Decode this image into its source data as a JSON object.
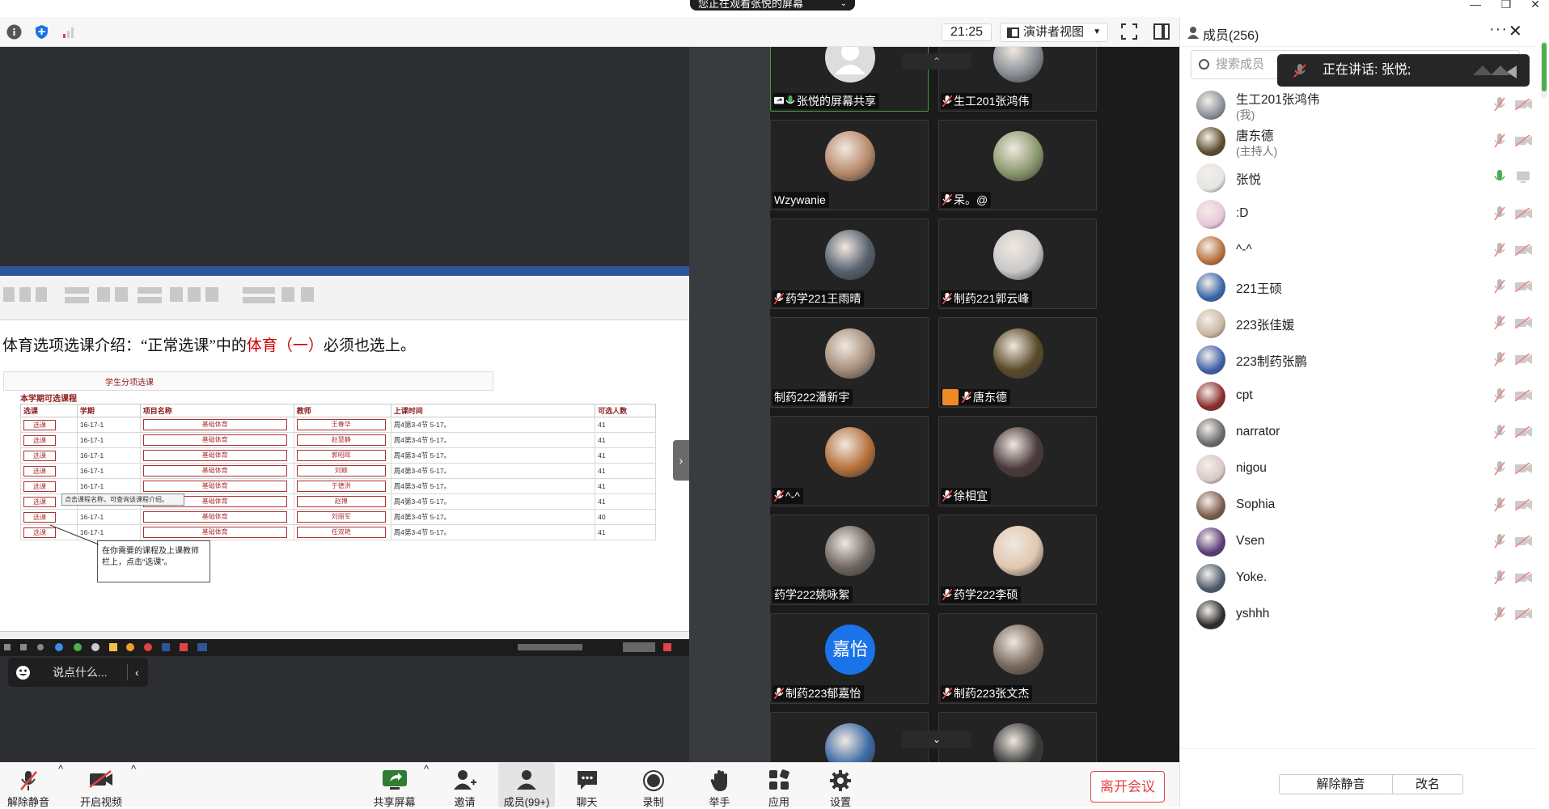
{
  "top": {
    "share_banner": "您正在观看张悦的屏幕",
    "minimize": "—",
    "restore": "❐",
    "close": "✕"
  },
  "toolbar": {
    "time": "21:25",
    "view_mode": "演讲者视图"
  },
  "doc": {
    "intro_a": "体育选项选课介绍：“正常选课”中的",
    "intro_red": "体育（一）",
    "intro_b": "必须也选上。",
    "section_title": "学生分项选课",
    "table_title": "本学期可选课程",
    "headers": [
      "选课",
      "学期",
      "项目名称",
      "教师",
      "上课时间",
      "可选人数"
    ],
    "rows": [
      {
        "btn": "选课",
        "term": "16-17-1",
        "proj": "基础体育",
        "teacher": "王春华",
        "time": "周4第3-4节 5-17。",
        "cap": "41"
      },
      {
        "btn": "选课",
        "term": "16-17-1",
        "proj": "基础体育",
        "teacher": "赵慧静",
        "time": "周4第3-4节 5-17。",
        "cap": "41"
      },
      {
        "btn": "选课",
        "term": "16-17-1",
        "proj": "基础体育",
        "teacher": "郭昭晖",
        "time": "周4第3-4节 5-17。",
        "cap": "41"
      },
      {
        "btn": "选课",
        "term": "16-17-1",
        "proj": "基础体育",
        "teacher": "刘颖",
        "time": "周4第3-4节 5-17。",
        "cap": "41"
      },
      {
        "btn": "选课",
        "term": "16-17-1",
        "proj": "基础体育",
        "teacher": "于德洪",
        "time": "周4第3-4节 5-17。",
        "cap": "41"
      },
      {
        "btn": "选课",
        "term": "16-17-1",
        "proj": "基础体育",
        "teacher": "赵博",
        "time": "周4第3-4节 5-17。",
        "cap": "41"
      },
      {
        "btn": "选课",
        "term": "16-17-1",
        "proj": "基础体育",
        "teacher": "刘丽军",
        "time": "周4第3-4节 5-17。",
        "cap": "40"
      },
      {
        "btn": "选课",
        "term": "16-17-1",
        "proj": "基础体育",
        "teacher": "任双艳",
        "time": "周4第3-4节 5-17。",
        "cap": "41"
      }
    ],
    "tip1": "点击课程名称，可查询该课程介绍。",
    "tip2": "在你需要的课程及上课教师栏上，点击“选课”。"
  },
  "chat_placeholder": "说点什么...",
  "gallery": {
    "tiles": [
      {
        "name": "张悦的屏幕共享",
        "share": true,
        "avatar": "default",
        "color": "#ddd"
      },
      {
        "name": "生工201张鸿伟",
        "share": false,
        "avatar": "photo",
        "color": "#8a8f96"
      },
      {
        "name": "Wzywanie",
        "share": false,
        "avatar": "photo",
        "color": "#b88a6b",
        "nomic": true
      },
      {
        "name": "呆。@",
        "share": false,
        "avatar": "photo",
        "color": "#8c9a6e"
      },
      {
        "name": "药学221王雨晴",
        "share": false,
        "avatar": "photo",
        "color": "#55606e"
      },
      {
        "name": "制药221郭云峰",
        "share": false,
        "avatar": "photo",
        "color": "#c9c9c9"
      },
      {
        "name": "制药222潘新宇",
        "share": false,
        "avatar": "photo",
        "color": "#a58d7a",
        "nomic": true
      },
      {
        "name": "唐东德",
        "share": false,
        "avatar": "photo",
        "color": "#5b4b2a",
        "host": true
      },
      {
        "name": "^-^",
        "share": false,
        "avatar": "photo",
        "color": "#b6703a"
      },
      {
        "name": "徐相宜",
        "share": false,
        "avatar": "photo",
        "color": "#4a3a3a"
      },
      {
        "name": "药学222姚咏絮",
        "share": false,
        "avatar": "photo",
        "color": "#6e6660",
        "nomic": true
      },
      {
        "name": "药学222李硕",
        "share": false,
        "avatar": "photo",
        "color": "#e0c8b0"
      },
      {
        "name": "制药223郁嘉怡",
        "share": false,
        "avatar": "text",
        "avatar_text": "嘉怡",
        "color": "#1a73e8"
      },
      {
        "name": "制药223张文杰",
        "share": false,
        "avatar": "photo",
        "color": "#7a6a5e"
      },
      {
        "name": "",
        "share": false,
        "avatar": "photo",
        "color": "#3d6aa6"
      },
      {
        "name": "",
        "share": false,
        "avatar": "photo",
        "color": "#3a3a3a"
      }
    ]
  },
  "panel": {
    "title": "成员(256)",
    "more": "···",
    "close": "✕",
    "search_placeholder": "搜索成员",
    "speaking": "正在讲话: 张悦;",
    "members": [
      {
        "name": "生工201张鸿伟",
        "role": "(我)",
        "color": "#8a8f96",
        "mic": "muted",
        "cam": "off"
      },
      {
        "name": "唐东德",
        "role": "(主持人)",
        "color": "#5b4b2a",
        "mic": "muted",
        "cam": "off"
      },
      {
        "name": "张悦",
        "role": "",
        "color": "#e5e5e5",
        "mic": "on",
        "cam": "share"
      },
      {
        "name": ":D",
        "role": "",
        "color": "#e7c7d8",
        "mic": "muted",
        "cam": "off"
      },
      {
        "name": "^-^",
        "role": "",
        "color": "#b6703a",
        "mic": "muted",
        "cam": "off"
      },
      {
        "name": "221王硕",
        "role": "",
        "color": "#3565a8",
        "mic": "muted",
        "cam": "off"
      },
      {
        "name": "223张佳媛",
        "role": "",
        "color": "#c8b8a0",
        "mic": "muted",
        "cam": "off"
      },
      {
        "name": "223制药张鹏",
        "role": "",
        "color": "#3b5fa8",
        "mic": "muted",
        "cam": "off"
      },
      {
        "name": "cpt",
        "role": "",
        "color": "#8a2a2a",
        "mic": "muted",
        "cam": "off"
      },
      {
        "name": "narrator",
        "role": "",
        "color": "#6a6a6a",
        "mic": "muted",
        "cam": "off"
      },
      {
        "name": "nigou",
        "role": "",
        "color": "#d8c8c8",
        "mic": "muted",
        "cam": "off"
      },
      {
        "name": "Sophia",
        "role": "",
        "color": "#7a5a4a",
        "mic": "muted",
        "cam": "off"
      },
      {
        "name": "Vsen",
        "role": "",
        "color": "#5a3a7a",
        "mic": "muted",
        "cam": "off"
      },
      {
        "name": "Yoke.",
        "role": "",
        "color": "#4a5a6a",
        "mic": "muted",
        "cam": "off"
      },
      {
        "name": "yshhh",
        "role": "",
        "color": "#2a2a2a",
        "mic": "muted",
        "cam": "off"
      }
    ],
    "unmute_all": "解除静音",
    "rename": "改名"
  },
  "bottom": {
    "unmute": "解除静音",
    "start_video": "开启视频",
    "share": "共享屏幕",
    "invite": "邀请",
    "members": "成员(99+)",
    "chat": "聊天",
    "record": "录制",
    "raise_hand": "举手",
    "apps": "应用",
    "settings": "设置",
    "leave": "离开会议"
  },
  "colors": {
    "accent_red": "#e24343",
    "active_green": "#4caf50",
    "avatar_blue": "#1a73e8"
  }
}
